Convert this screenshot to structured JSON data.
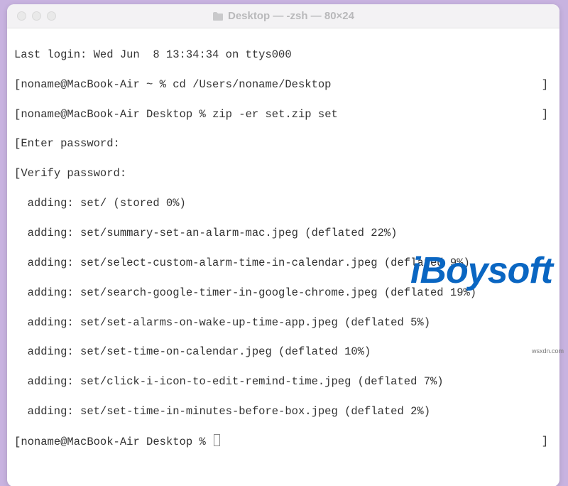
{
  "window": {
    "title": "Desktop — -zsh — 80×24"
  },
  "terminal": {
    "last_login": "Last login: Wed Jun  8 13:34:34 on ttys000",
    "prompt1_prefix": "noname@MacBook-Air ~ % ",
    "cmd1": "cd /Users/noname/Desktop",
    "prompt2_prefix": "noname@MacBook-Air Desktop % ",
    "cmd2": "zip -er set.zip set",
    "enter_pw": "Enter password:",
    "verify_pw": "Verify password:",
    "outputs": [
      "  adding: set/ (stored 0%)",
      "  adding: set/summary-set-an-alarm-mac.jpeg (deflated 22%)",
      "  adding: set/select-custom-alarm-time-in-calendar.jpeg (deflated 9%)",
      "  adding: set/search-google-timer-in-google-chrome.jpeg (deflated 19%)",
      "  adding: set/set-alarms-on-wake-up-time-app.jpeg (deflated 5%)",
      "  adding: set/set-time-on-calendar.jpeg (deflated 10%)",
      "  adding: set/click-i-icon-to-edit-remind-time.jpeg (deflated 7%)",
      "  adding: set/set-time-in-minutes-before-box.jpeg (deflated 2%)"
    ],
    "prompt3_prefix": "noname@MacBook-Air Desktop % "
  },
  "watermark": "iBoysoft",
  "tiny": "wsxdn.com"
}
